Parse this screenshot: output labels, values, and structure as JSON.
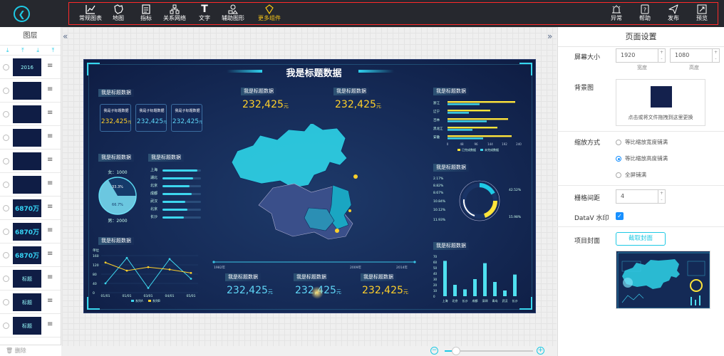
{
  "topbar": {
    "tools": [
      {
        "label": "常规图表",
        "icon": "chart-icon"
      },
      {
        "label": "地图",
        "icon": "map-icon"
      },
      {
        "label": "指标",
        "icon": "indicator-icon"
      },
      {
        "label": "关系网络",
        "icon": "network-icon"
      },
      {
        "label": "文字",
        "icon": "text-icon"
      },
      {
        "label": "辅助图形",
        "icon": "shapes-icon"
      },
      {
        "label": "更多组件",
        "icon": "more-components-icon"
      }
    ],
    "right_tools": [
      {
        "label": "异常",
        "icon": "alarm-icon"
      },
      {
        "label": "帮助",
        "icon": "help-icon"
      },
      {
        "label": "发布",
        "icon": "publish-icon"
      },
      {
        "label": "预览",
        "icon": "preview-icon"
      }
    ]
  },
  "left_panel": {
    "title": "图层",
    "delete_label": "删除",
    "layers": [
      {
        "thumb": "2016"
      },
      {
        "thumb": ""
      },
      {
        "thumb": ""
      },
      {
        "thumb": ""
      },
      {
        "thumb": ""
      },
      {
        "thumb": ""
      },
      {
        "thumb": "6870万"
      },
      {
        "thumb": "6870万"
      },
      {
        "thumb": "6870万"
      },
      {
        "thumb": "标题"
      },
      {
        "thumb": "标题"
      },
      {
        "thumb": "标题"
      }
    ]
  },
  "dashboard": {
    "title": "我是标题数据",
    "section_label": "我是标题数据",
    "card_label": "我是子标题数据",
    "value": "232,425",
    "unit": "元",
    "gauge": {
      "top": "女：1000",
      "bottom": "男：2000",
      "pct_a": "33.3%",
      "pct_b": "66.7%"
    },
    "progress_labels": [
      "上海",
      "湖北",
      "北京",
      "成都",
      "武汉",
      "北京",
      "长沙"
    ],
    "hbar": {
      "cities": [
        "浙江",
        "辽宁",
        "吉林",
        "黑龙江",
        "安徽"
      ],
      "ticks": [
        "0",
        "48",
        "96",
        "144",
        "192",
        "240"
      ],
      "legend": [
        "已完成数据",
        "未完成数据"
      ]
    },
    "ring_labels_left": [
      "2.17%",
      "8.82%",
      "8.67%",
      "10.84%",
      "10.12%",
      "11.93%"
    ],
    "ring_labels_right": [
      "42.52%",
      "15.98%"
    ],
    "line_chart": {
      "ylabel": "单位",
      "yticks": [
        "160",
        "120",
        "80",
        "40",
        "0"
      ],
      "xticks": [
        "01/01",
        "01/01",
        "03/01",
        "04/01",
        "05/01"
      ],
      "legend": [
        "系列A",
        "系列B"
      ]
    },
    "timeline": {
      "start": "1982年",
      "mid": "2009年",
      "end": "2014年"
    },
    "vbar": {
      "yticks": [
        "70",
        "60",
        "50",
        "40",
        "30",
        "20",
        "10",
        "0"
      ],
      "xticks": [
        "上海",
        "北京",
        "长沙",
        "成都",
        "深圳",
        "青岛",
        "武汉",
        "长沙"
      ]
    }
  },
  "right_panel": {
    "title": "页面设置",
    "screen_size_label": "屏幕大小",
    "width": "1920",
    "height": "1080",
    "width_sub": "宽度",
    "height_sub": "高度",
    "bg_label": "背景图",
    "upload_hint": "点击或将文件拖拽到这里更换",
    "scale_label": "缩放方式",
    "scale_options": [
      "等比缩放宽度铺满",
      "等比缩放高度铺满",
      "全屏铺满"
    ],
    "grid_label": "栅格间距",
    "grid_value": "4",
    "watermark_label": "DataV 水印",
    "cover_label": "项目封面",
    "cover_button": "截取封面"
  },
  "colors": {
    "accent": "#1ec9e4",
    "topbar": "#26282e",
    "dash_bg": "#152a56",
    "gold": "#ffd02a"
  }
}
